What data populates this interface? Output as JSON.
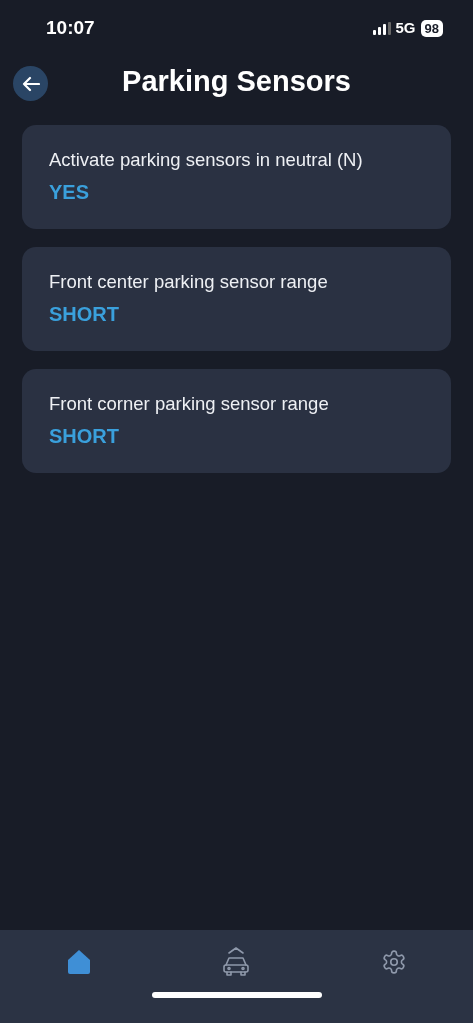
{
  "status_bar": {
    "time": "10:07",
    "network": "5G",
    "battery": "98"
  },
  "header": {
    "title": "Parking Sensors"
  },
  "settings": [
    {
      "label": "Activate parking sensors in neutral (N)",
      "value": "YES"
    },
    {
      "label": "Front center parking sensor range",
      "value": "SHORT"
    },
    {
      "label": "Front corner parking sensor range",
      "value": "SHORT"
    }
  ],
  "tab_bar": [
    {
      "kind": "home",
      "selected": true
    },
    {
      "kind": "car",
      "selected": false
    },
    {
      "kind": "settings",
      "selected": false
    }
  ]
}
